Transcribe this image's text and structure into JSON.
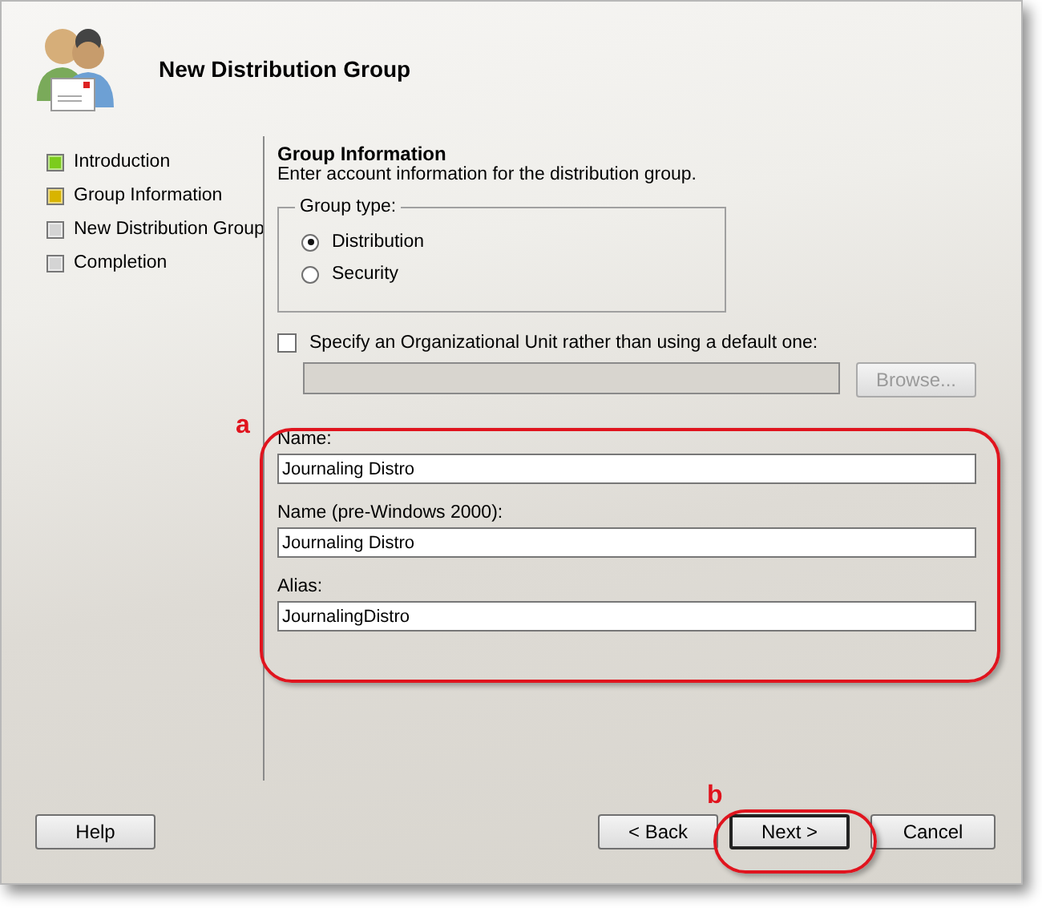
{
  "window": {
    "title": "New Distribution Group"
  },
  "steps": [
    {
      "label": "Introduction",
      "color": "#7ccc1c"
    },
    {
      "label": "Group Information",
      "color": "#d8b400"
    },
    {
      "label": "New Distribution Group",
      "color": "#d4d4d4"
    },
    {
      "label": "Completion",
      "color": "#d4d4d4"
    }
  ],
  "page": {
    "heading": "Group Information",
    "description": "Enter account information for the distribution group."
  },
  "group_type": {
    "legend": "Group type:",
    "options": [
      {
        "label": "Distribution",
        "selected": true
      },
      {
        "label": "Security",
        "selected": false
      }
    ]
  },
  "ou": {
    "label": "Specify an Organizational Unit rather than using a default one:",
    "checked": false,
    "browse": {
      "label": "Browse...",
      "disabled": true
    }
  },
  "fields": [
    {
      "label": "Name:",
      "value": "Journaling Distro"
    },
    {
      "label": "Name (pre-Windows 2000):",
      "value": "Journaling Distro"
    },
    {
      "label": "Alias:",
      "value": "JournalingDistro"
    }
  ],
  "buttons": {
    "help": "Help",
    "back": "< Back",
    "next": "Next >",
    "cancel": "Cancel"
  },
  "callouts": [
    {
      "label": "a"
    },
    {
      "label": "b"
    }
  ]
}
